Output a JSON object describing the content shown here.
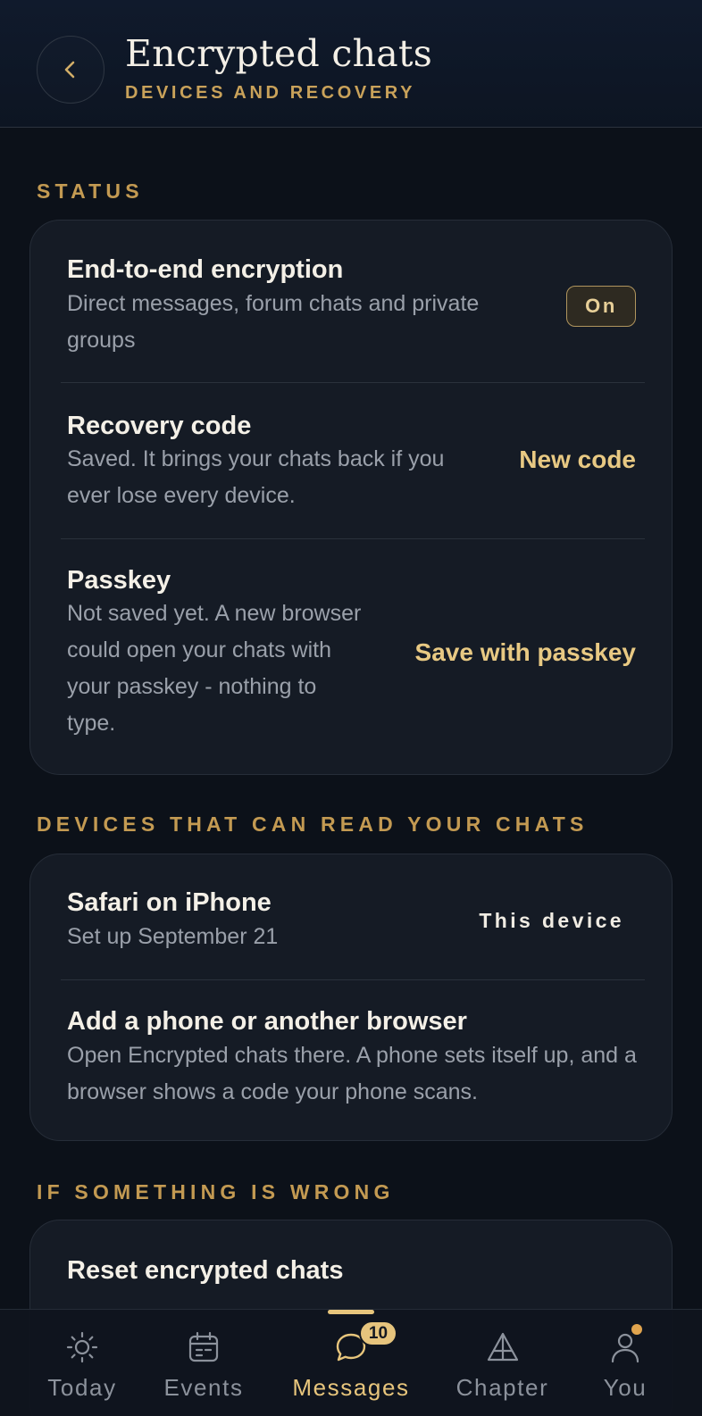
{
  "header": {
    "back_icon": "chevron-left-icon",
    "title": "Encrypted chats",
    "subtitle": "DEVICES AND RECOVERY"
  },
  "status": {
    "label": "STATUS",
    "rows": [
      {
        "title": "End-to-end encryption",
        "description": "Direct messages, forum chats and private groups",
        "badge": "On"
      },
      {
        "title": "Recovery code",
        "description": "Saved. It brings your chats back if you ever lose every device.",
        "action": "New code"
      },
      {
        "title": "Passkey",
        "description": "Not saved yet. A new browser could open your chats with your passkey - nothing to type.",
        "action": "Save with passkey"
      }
    ]
  },
  "devices": {
    "label": "DEVICES THAT CAN READ YOUR CHATS",
    "rows": [
      {
        "title": "Safari on iPhone",
        "description": "Set up September 21",
        "tag": "This device"
      },
      {
        "title": "Add a phone or another browser",
        "description": "Open Encrypted chats there. A phone sets itself up, and a browser shows a code your phone scans."
      }
    ]
  },
  "problems": {
    "label": "IF SOMETHING IS WRONG",
    "rows": [
      {
        "title": "Reset encrypted chats"
      }
    ]
  },
  "tabbar": {
    "active": "Messages",
    "items": [
      {
        "label": "Today",
        "icon": "sun-icon"
      },
      {
        "label": "Events",
        "icon": "calendar-icon"
      },
      {
        "label": "Messages",
        "icon": "chat-bubble-icon",
        "badge": "10"
      },
      {
        "label": "Chapter",
        "icon": "pyramid-icon"
      },
      {
        "label": "You",
        "icon": "person-icon"
      }
    ]
  },
  "colors": {
    "background": "#0c1119",
    "card": "#151b25",
    "accent": "#e7c57c",
    "section_label": "#c39a52"
  }
}
